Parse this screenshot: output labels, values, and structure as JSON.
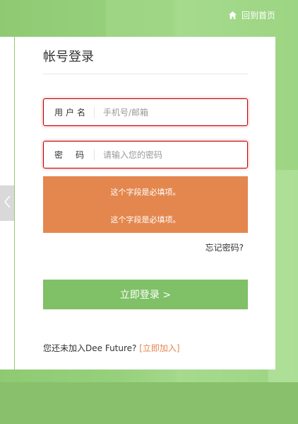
{
  "home": {
    "label": "回到首页",
    "icon": "home-icon"
  },
  "login": {
    "title": "帐号登录",
    "username": {
      "label": "用户名",
      "placeholder": "手机号/邮箱",
      "value": ""
    },
    "password": {
      "label": "密码",
      "placeholder": "请输入您的密码",
      "value": ""
    },
    "errors": [
      "这个字段是必填项。",
      "这个字段是必填项。"
    ],
    "forgot": "忘记密码?",
    "submit": "立即登录 >",
    "join_text": "您还未加入Dee Future?",
    "join_link": "[立即加入]"
  },
  "colors": {
    "accent_green": "#80c067",
    "error_orange": "#e4874f",
    "error_border": "#c00000"
  }
}
